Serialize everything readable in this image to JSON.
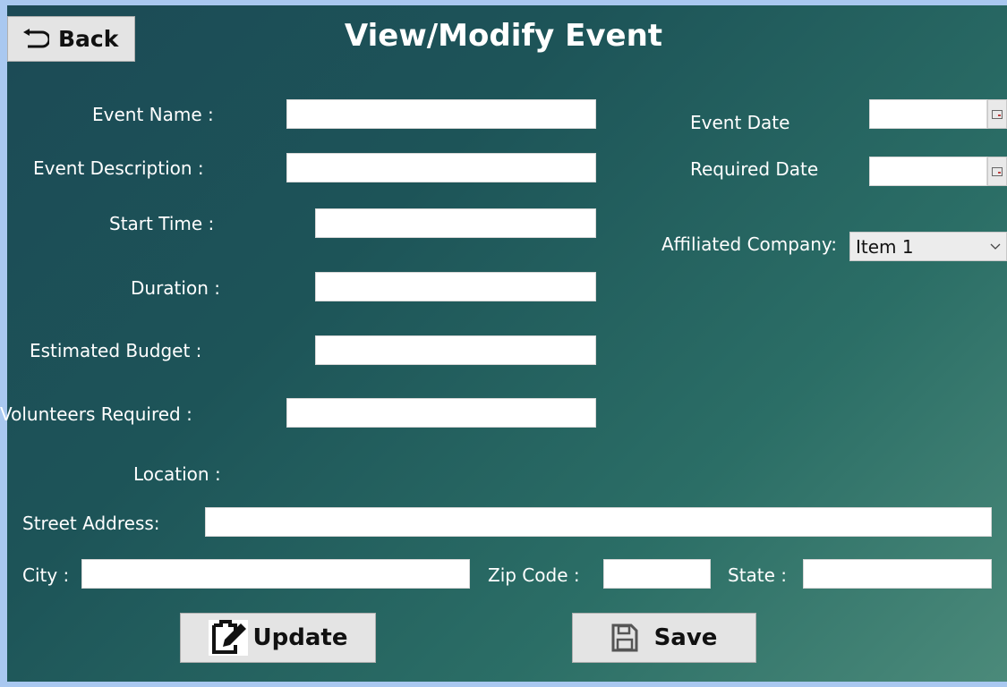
{
  "window": {
    "title": "View/Modify Event"
  },
  "toolbar": {
    "back_label": "Back"
  },
  "form": {
    "event_name_label": "Event Name :",
    "event_description_label": "Event Description :",
    "start_time_label": "Start Time :",
    "duration_label": "Duration :",
    "estimated_budget_label": "Estimated Budget :",
    "volunteers_required_label": "Volunteers Required :",
    "location_label": "Location :",
    "street_address_label": "Street Address:",
    "city_label": "City :",
    "zip_code_label": "Zip Code :",
    "state_label": "State :",
    "event_date_label": "Event Date",
    "required_date_label": "Required Date",
    "affiliated_company_label": "Affiliated Company:",
    "affiliated_company_value": "Item 1",
    "event_name_value": "",
    "event_description_value": "",
    "start_time_value": "",
    "duration_value": "",
    "estimated_budget_value": "",
    "volunteers_required_value": "",
    "street_address_value": "",
    "city_value": "",
    "zip_code_value": "",
    "state_value": "",
    "event_date_value": "",
    "required_date_value": ""
  },
  "actions": {
    "update_label": "Update",
    "save_label": "Save"
  },
  "icons": {
    "back": "undo-arrow-icon",
    "update": "edit-icon",
    "save": "floppy-disk-icon",
    "calendar": "calendar-icon",
    "dropdown": "chevron-down-icon"
  }
}
